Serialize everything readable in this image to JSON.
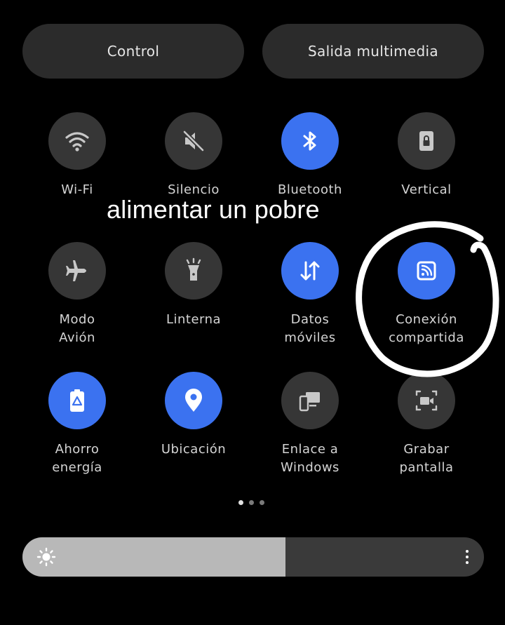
{
  "top_buttons": {
    "control": "Control",
    "media_output": "Salida multimedia"
  },
  "tiles": [
    {
      "label": "Wi-Fi",
      "icon": "wifi-icon",
      "state": "off"
    },
    {
      "label": "Silencio",
      "icon": "mute-icon",
      "state": "off"
    },
    {
      "label": "Bluetooth",
      "icon": "bluetooth-icon",
      "state": "on"
    },
    {
      "label": "Vertical",
      "icon": "portrait-lock-icon",
      "state": "off"
    },
    {
      "label": "Modo\nAvión",
      "icon": "airplane-icon",
      "state": "off"
    },
    {
      "label": "Linterna",
      "icon": "flashlight-icon",
      "state": "off"
    },
    {
      "label": "Datos\nmóviles",
      "icon": "mobile-data-icon",
      "state": "on"
    },
    {
      "label": "Conexión\ncompartida",
      "icon": "hotspot-icon",
      "state": "on"
    },
    {
      "label": "Ahorro\nenergía",
      "icon": "battery-saver-icon",
      "state": "on"
    },
    {
      "label": "Ubicación",
      "icon": "location-icon",
      "state": "on"
    },
    {
      "label": "Enlace a\nWindows",
      "icon": "link-to-windows-icon",
      "state": "off"
    },
    {
      "label": "Grabar\npantalla",
      "icon": "screen-record-icon",
      "state": "off"
    }
  ],
  "overlay_caption": "alimentar un pobre",
  "page_indicator": {
    "count": 3,
    "active": 1
  },
  "brightness": {
    "level": 0.57,
    "icon": "sun-icon",
    "more_icon": "more-vertical-icon"
  },
  "colors": {
    "active": "#3b72f0",
    "inactive": "#363636",
    "background": "#000000"
  }
}
